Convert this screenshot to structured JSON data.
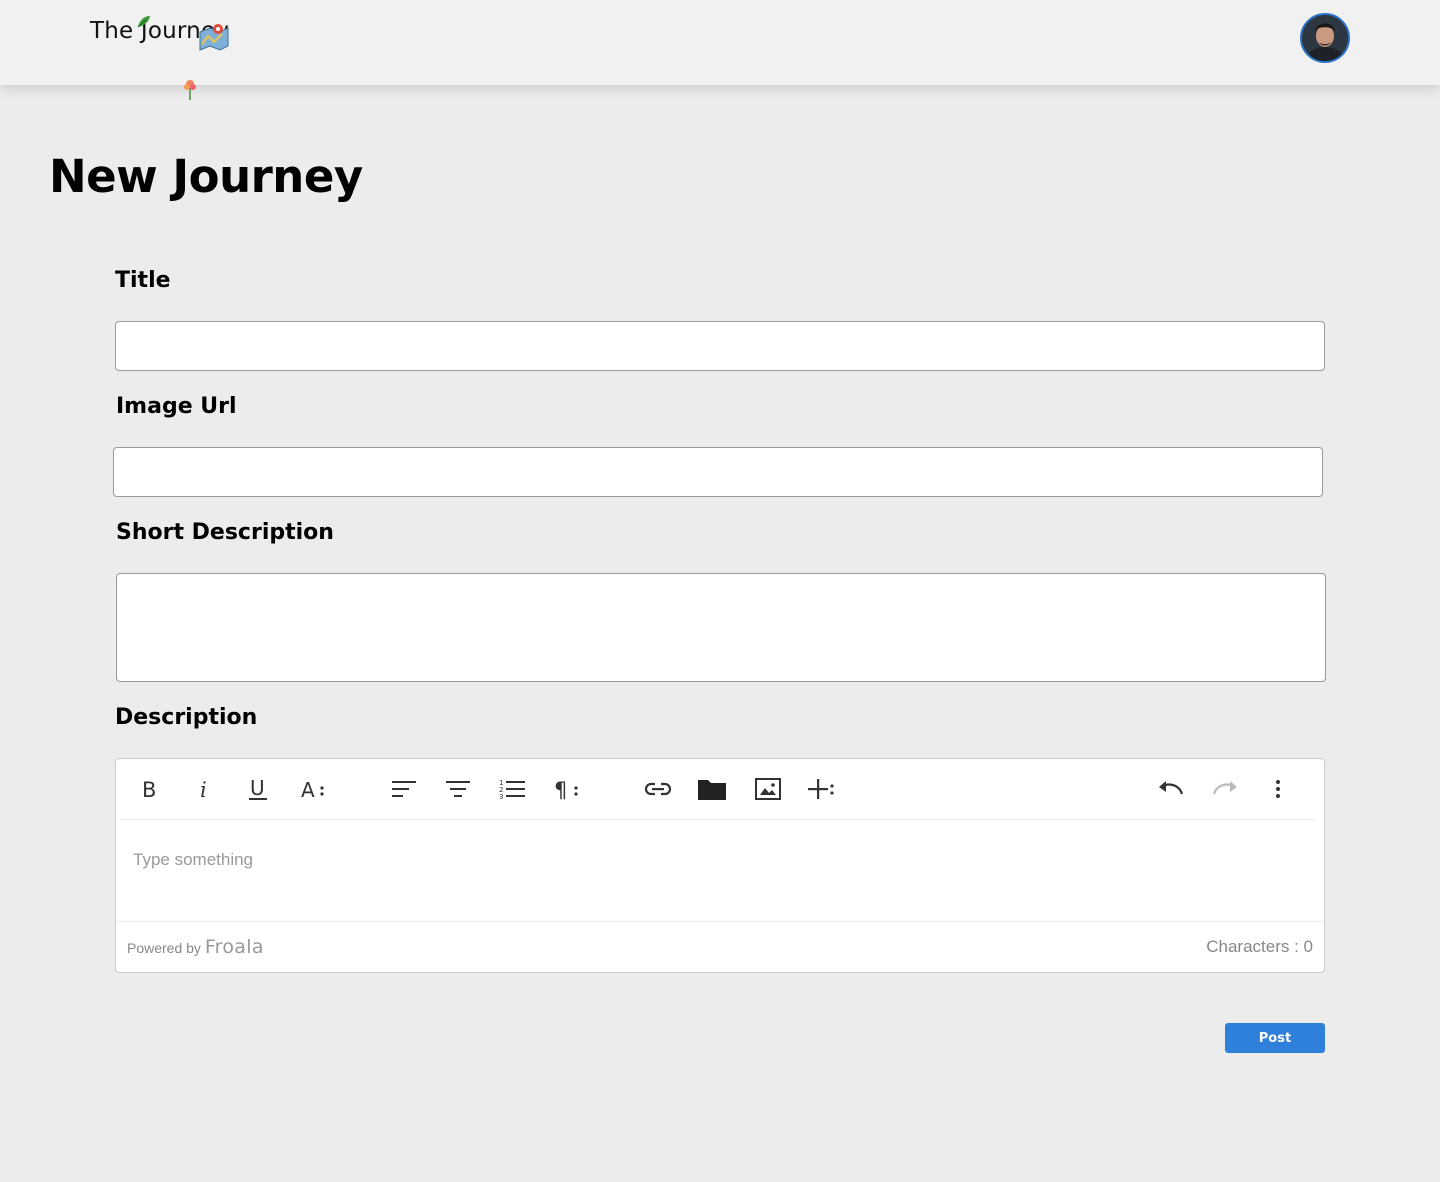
{
  "header": {
    "logo_text": "The Journey",
    "avatar_icon": "user-avatar"
  },
  "page": {
    "title": "New Journey"
  },
  "form": {
    "title_label": "Title",
    "title_value": "",
    "image_url_label": "Image Url",
    "image_url_value": "",
    "short_description_label": "Short Description",
    "short_description_value": "",
    "description_label": "Description"
  },
  "editor": {
    "toolbar": [
      {
        "name": "bold-icon"
      },
      {
        "name": "italic-icon"
      },
      {
        "name": "underline-icon"
      },
      {
        "name": "font-size-icon"
      },
      {
        "name": "align-left-icon"
      },
      {
        "name": "align-center-icon"
      },
      {
        "name": "ordered-list-icon"
      },
      {
        "name": "paragraph-format-icon"
      },
      {
        "name": "link-icon"
      },
      {
        "name": "folder-icon"
      },
      {
        "name": "image-icon"
      },
      {
        "name": "insert-more-icon"
      },
      {
        "name": "undo-icon"
      },
      {
        "name": "redo-icon"
      },
      {
        "name": "more-vertical-icon"
      }
    ],
    "placeholder": "Type something",
    "powered_by": "Powered by",
    "brand": "Froala",
    "char_count": "Characters : 0"
  },
  "actions": {
    "post_label": "Post"
  },
  "colors": {
    "accent": "#2f80db",
    "background": "#ececec",
    "header": "#f1f1f1"
  }
}
